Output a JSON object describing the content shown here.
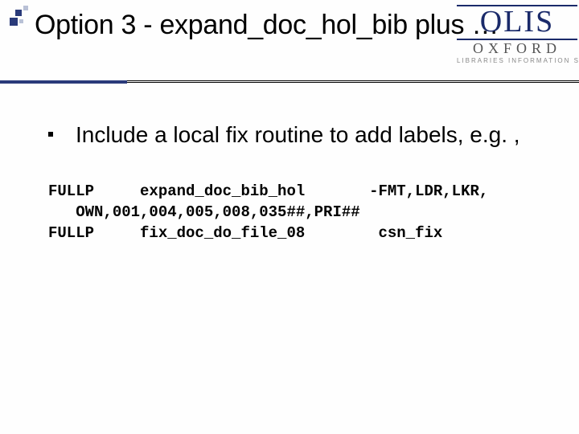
{
  "title": "Option 3 - expand_doc_hol_bib plus …",
  "logo": {
    "brand": "OLIS",
    "org": "OXFORD",
    "sub": "LIBRARIES  INFORMATION SYSTEM"
  },
  "bullet": "Include a local fix routine to add labels, e.g. ,",
  "code_line1": "FULLP     expand_doc_bib_hol       -FMT,LDR,LKR,",
  "code_line2": "   OWN,001,004,005,008,035##,PRI##",
  "code_line3": "FULLP     fix_doc_do_file_08        csn_fix"
}
